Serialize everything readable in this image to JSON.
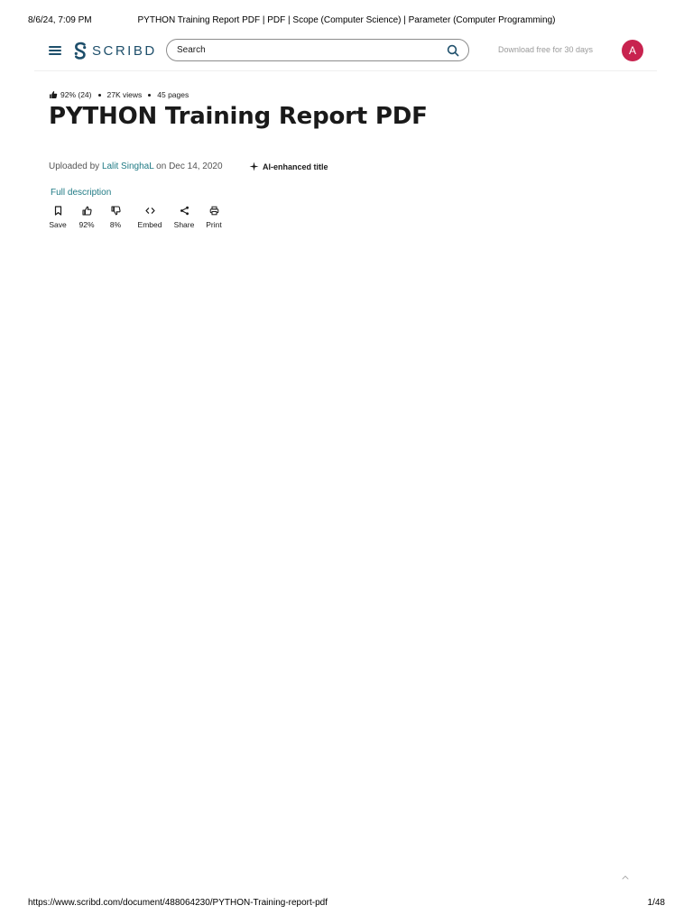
{
  "print": {
    "datetime": "8/6/24, 7:09 PM",
    "page_title": "PYTHON Training Report PDF | PDF | Scope (Computer Science) | Parameter (Computer Programming)",
    "url": "https://www.scribd.com/document/488064230/PYTHON-Training-report-pdf",
    "page_count": "1/48"
  },
  "nav": {
    "logo_text": "SCRIBD",
    "search_placeholder": "Search",
    "download_label": "Download free for 30 days",
    "avatar_initial": "A"
  },
  "doc": {
    "rating": "92% (24)",
    "views": "27K views",
    "pages": "45 pages",
    "title": "PYTHON Training Report PDF",
    "uploaded_prefix": "Uploaded by ",
    "uploader": "Lalit SinghaL",
    "uploaded_suffix": " on Dec 14, 2020",
    "ai_label": "AI-enhanced title",
    "full_description": "Full description"
  },
  "actions": {
    "save": "Save",
    "like": "92%",
    "dislike": "8%",
    "embed": "Embed",
    "share": "Share",
    "print": "Print"
  },
  "colors": {
    "brand": "#1e4f6b",
    "link": "#1f7a84",
    "avatar": "#c8234f"
  },
  "icons": [
    "menu-icon",
    "scribd-logo-icon",
    "search-icon",
    "thumbs-up-icon",
    "sparkle-icon",
    "bookmark-icon",
    "thumbs-down-icon",
    "code-icon",
    "share-icon",
    "print-icon",
    "chevron-up-icon"
  ]
}
